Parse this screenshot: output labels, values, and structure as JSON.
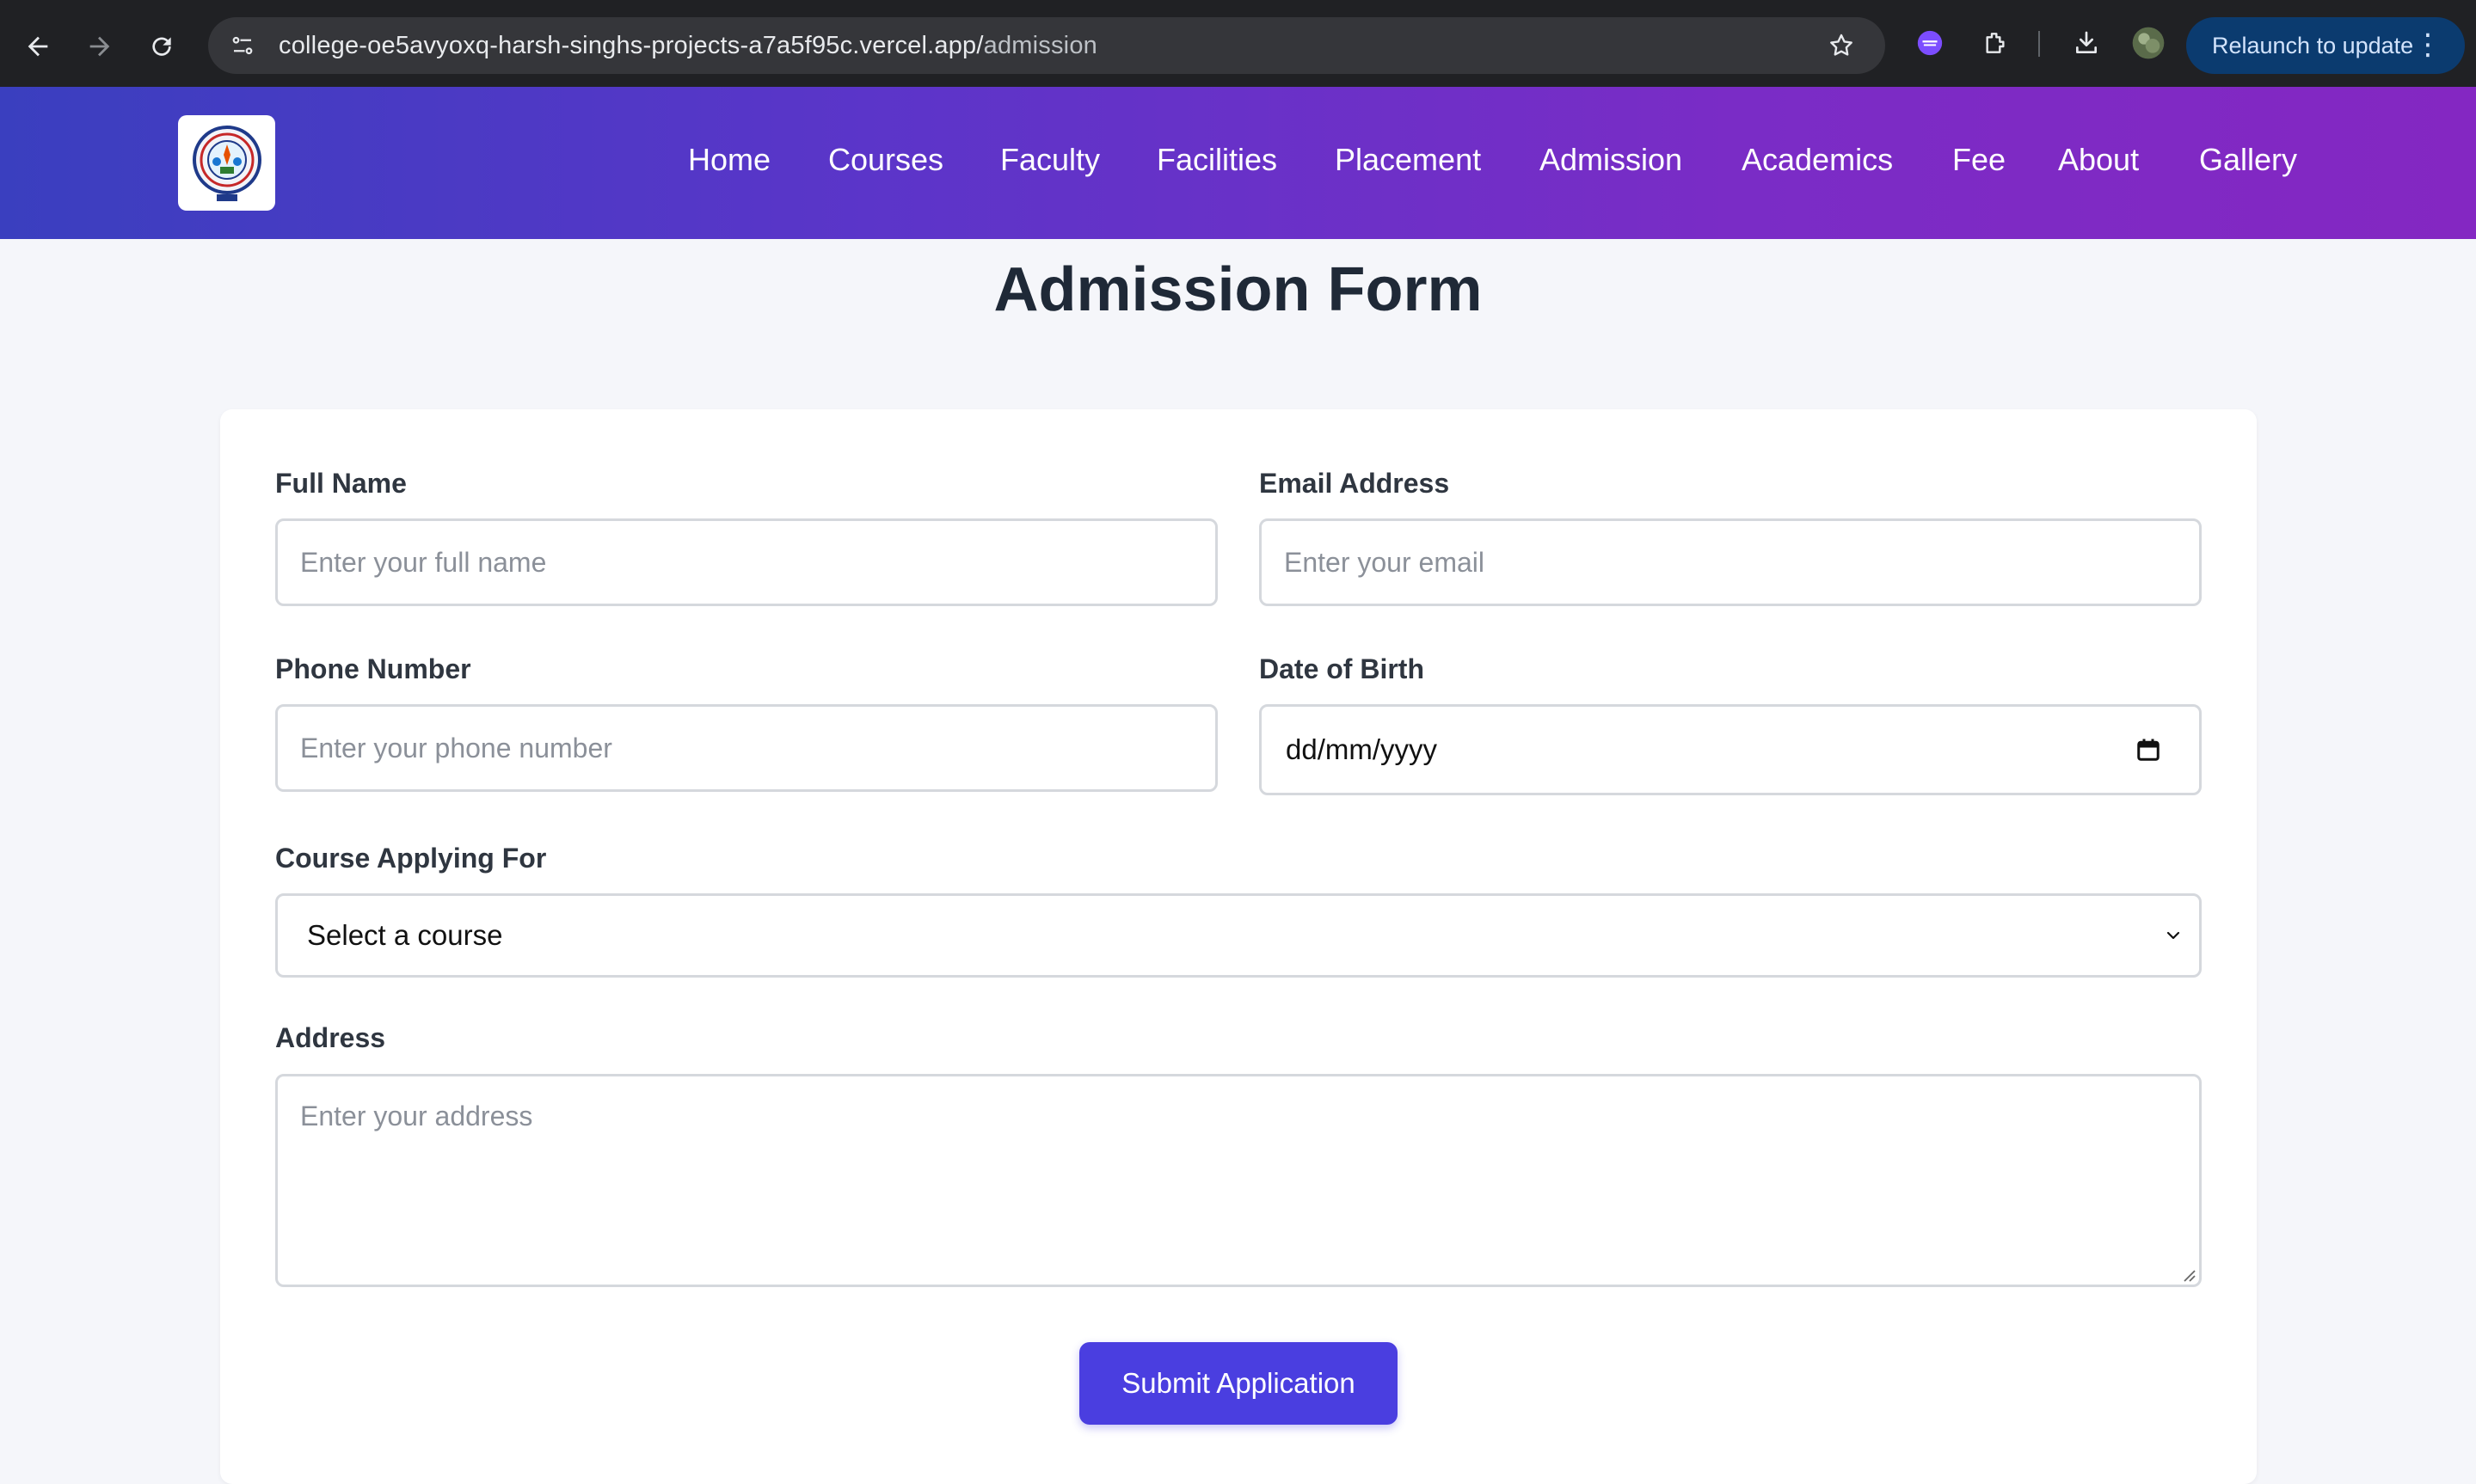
{
  "browser": {
    "url_host": "college-oe5avyoxq-harsh-singhs-projects-a7a5f95c.vercel.app/",
    "url_path": "admission",
    "relaunch_label": "Relaunch to update"
  },
  "site": {
    "logo_alt": "SRGI",
    "nav": [
      {
        "label": "Home"
      },
      {
        "label": "Courses"
      },
      {
        "label": "Faculty"
      },
      {
        "label": "Facilities"
      },
      {
        "label": "Placement"
      },
      {
        "label": "Admission"
      },
      {
        "label": "Academics"
      },
      {
        "label": "Fee"
      },
      {
        "label": "About"
      },
      {
        "label": "Gallery"
      }
    ]
  },
  "page": {
    "title": "Admission Form"
  },
  "form": {
    "full_name": {
      "label": "Full Name",
      "placeholder": "Enter your full name"
    },
    "email": {
      "label": "Email Address",
      "placeholder": "Enter your email"
    },
    "phone": {
      "label": "Phone Number",
      "placeholder": "Enter your phone number"
    },
    "dob": {
      "label": "Date of Birth",
      "value": "dd/mm/yyyy"
    },
    "course": {
      "label": "Course Applying For",
      "selected": "Select a course"
    },
    "address": {
      "label": "Address",
      "placeholder": "Enter your address"
    },
    "submit_label": "Submit Application"
  },
  "colors": {
    "header_gradient_start": "#3a3fbf",
    "header_gradient_end": "#8427c2",
    "button": "#4a3ee0",
    "title_text": "#1f2937"
  }
}
